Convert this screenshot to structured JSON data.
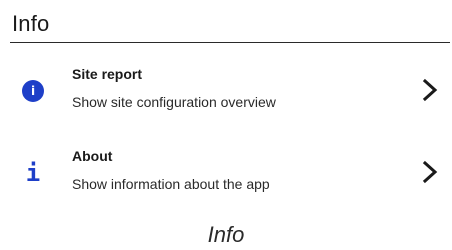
{
  "section": {
    "title": "Info"
  },
  "items": [
    {
      "icon": "info-circle-icon",
      "title": "Site report",
      "description": "Show site configuration overview",
      "chevron": "chevron-right-icon"
    },
    {
      "icon": "info-icon",
      "glyph": "i",
      "title": "About",
      "description": "Show information about the app",
      "chevron": "chevron-right-icon"
    }
  ],
  "caption": "Info",
  "colors": {
    "accent": "#1e3fc8",
    "text": "#1a1a1a"
  }
}
